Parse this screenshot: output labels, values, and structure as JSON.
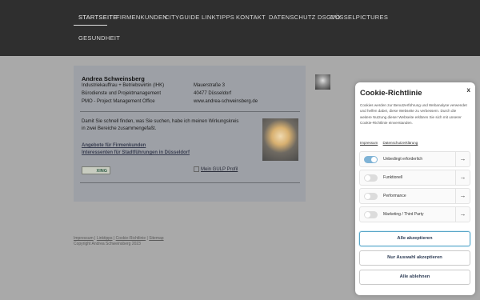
{
  "nav": {
    "items": [
      {
        "label": "Startseite",
        "active": true
      },
      {
        "label": "Firmenkunden",
        "active": false
      },
      {
        "label": "Cityguide",
        "active": false
      },
      {
        "label": "Linktipps",
        "active": false
      },
      {
        "label": "Kontakt",
        "active": false
      },
      {
        "label": "Datenschutz DSGVO",
        "active": false
      },
      {
        "label": "Düsselpictures",
        "active": false
      },
      {
        "label": "Gesundheit",
        "active": false
      }
    ]
  },
  "profile": {
    "name": "Andrea Schweinsberg",
    "left_lines": [
      "Industriekauffrau + Betriebswirtin (IHK)",
      "Bürodienste und Projektmanagement",
      "PMO - Project Management Office"
    ],
    "right_lines": [
      "Mauerstraße 3",
      "40477 Düsseldorf",
      "www.andrea-schweinsberg.de"
    ],
    "intro_lines": [
      "Damit Sie schnell finden, was Sie suchen, habe ich meinen Wirkungskreis",
      "in zwei Bereiche zusammengefaßt."
    ],
    "link_firmenkunden": "Angebote für Firmenkunden",
    "link_interessenten": "Interessenten für Stadtführungen in Düsseldorf",
    "xing_label": "XING",
    "gulp_label": "Mein GULP Profil"
  },
  "footer": {
    "links": [
      "Impressum",
      "Linktipps",
      "Cookie-Richtlinie",
      "Sitemap"
    ],
    "copyright": "Copyright Andrea Schweinsberg 2023"
  },
  "cookie": {
    "close": "x",
    "title": "Cookie-Richtlinie",
    "description": "Cookies werden zur Benutzerführung und Webanalyse verwendet und helfen dabei, diese Webseite zu verbessern. Durch die weitere Nutzung dieser Webseite erklären Sie sich mit unserer Cookie-Richtlinie einverstanden.",
    "link_impressum": "Impressum",
    "link_datenschutz": "Datenschutzerklärung",
    "categories": [
      {
        "label": "Unbedingt erforderlich",
        "enabled": true
      },
      {
        "label": "Funktionell",
        "enabled": false
      },
      {
        "label": "Performance",
        "enabled": false
      },
      {
        "label": "Marketing / Third Party",
        "enabled": false
      }
    ],
    "arrow": "→",
    "btn_accept_all": "Alle akzeptieren",
    "btn_accept_selection": "Nur Auswahl akzeptieren",
    "btn_decline_all": "Alle ablehnen"
  },
  "colors": {
    "header_bg": "#2f2f2f",
    "page_overlay": "#a9a9a9",
    "toggle_on": "#7fb3d6",
    "primary_button_border": "#5aa6c8"
  }
}
